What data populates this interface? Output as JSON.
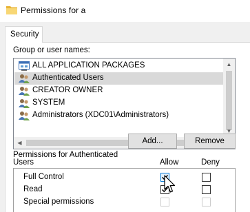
{
  "window": {
    "title": "Permissions for a",
    "icon": "folder-icon"
  },
  "tabs": [
    {
      "label": "Security",
      "active": true
    }
  ],
  "group_label": "Group or user names:",
  "users": [
    {
      "name": "ALL APPLICATION PACKAGES",
      "icon": "app-packages-icon",
      "selected": false
    },
    {
      "name": "Authenticated Users",
      "icon": "users-group-icon",
      "selected": true
    },
    {
      "name": "CREATOR OWNER",
      "icon": "users-group-icon",
      "selected": false
    },
    {
      "name": "SYSTEM",
      "icon": "users-group-icon",
      "selected": false
    },
    {
      "name": "Administrators (XDC01\\Administrators)",
      "icon": "users-group-icon",
      "selected": false
    }
  ],
  "buttons": {
    "add": "Add...",
    "remove": "Remove"
  },
  "permissions": {
    "header_line1": "Permissions for Authenticated",
    "header_line2": "Users",
    "allow_label": "Allow",
    "deny_label": "Deny",
    "rows": [
      {
        "name": "Full Control",
        "allow": true,
        "deny": false,
        "enabled": true
      },
      {
        "name": "Read",
        "allow": true,
        "deny": false,
        "enabled": true
      },
      {
        "name": "Special permissions",
        "allow": false,
        "deny": false,
        "enabled": false
      }
    ]
  },
  "colors": {
    "selection": "#d9d9d9",
    "face": "#f0f0f0",
    "accent": "#0078d7"
  }
}
